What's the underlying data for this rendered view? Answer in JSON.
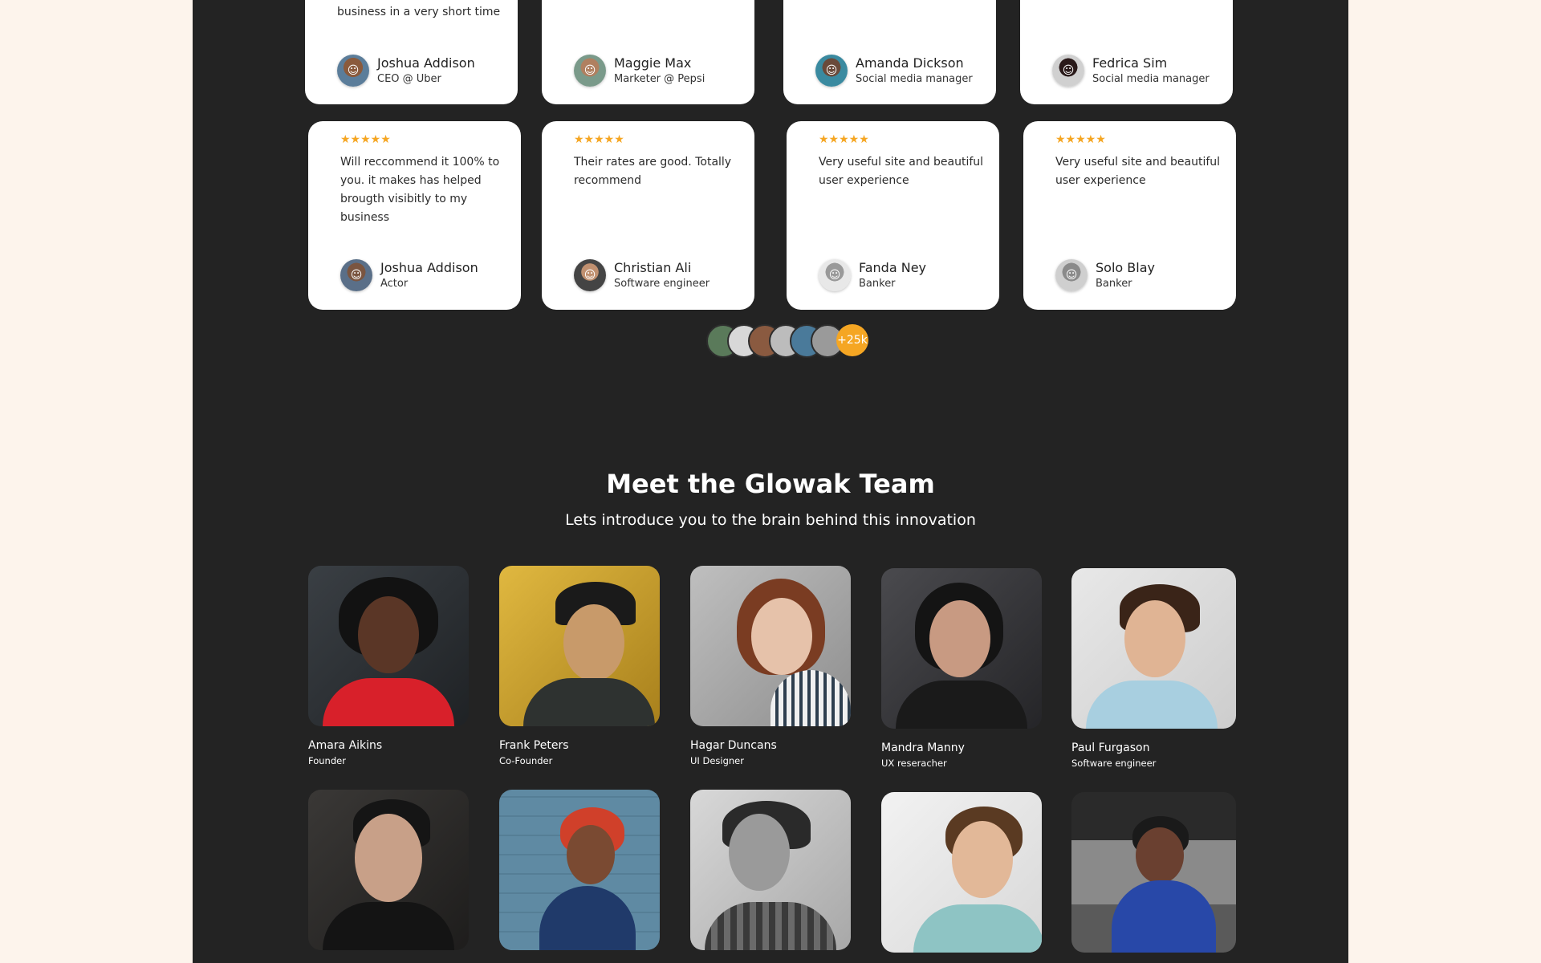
{
  "colors": {
    "page_bg": "#fdf4ec",
    "section_bg": "#232323",
    "card_bg": "#ffffff",
    "star": "#f5a623",
    "accent": "#f5a623"
  },
  "testimonials": {
    "row1": [
      {
        "quote_tail": "business in a very short time",
        "name": "Joshua Addison",
        "role": "CEO @ Uber"
      },
      {
        "quote_tail": "",
        "name": "Maggie Max",
        "role": "Marketer @ Pepsi"
      },
      {
        "quote_tail": "",
        "name": "Amanda Dickson",
        "role": "Social media manager"
      },
      {
        "quote_tail": "",
        "name": "Fedrica Sim",
        "role": "Social media manager"
      }
    ],
    "row2": [
      {
        "stars": "★★★★★",
        "quote": "Will reccommend it 100% to you. it makes has helped brougth visibitly to my business",
        "name": "Joshua Addison",
        "role": "Actor"
      },
      {
        "stars": "★★★★★",
        "quote": "Their rates are good. Totally recommend",
        "name": "Christian Ali",
        "role": "Software engineer"
      },
      {
        "stars": "★★★★★",
        "quote": "Very useful site and beautiful user experience",
        "name": "Fanda Ney",
        "role": "Banker"
      },
      {
        "stars": "★★★★★",
        "quote": "Very useful site and beautiful user experience",
        "name": "Solo Blay",
        "role": "Banker"
      }
    ]
  },
  "reviewer_count": "+25k",
  "team": {
    "title": "Meet the Glowak Team",
    "subtitle": "Lets introduce you to the brain behind this innovation",
    "members": [
      {
        "name": "Amara Aikins",
        "role": "Founder"
      },
      {
        "name": "Frank Peters",
        "role": "Co-Founder"
      },
      {
        "name": "Hagar Duncans",
        "role": "UI Designer"
      },
      {
        "name": "Mandra Manny",
        "role": "UX reseracher"
      },
      {
        "name": "Paul Furgason",
        "role": "Software engineer"
      }
    ]
  }
}
